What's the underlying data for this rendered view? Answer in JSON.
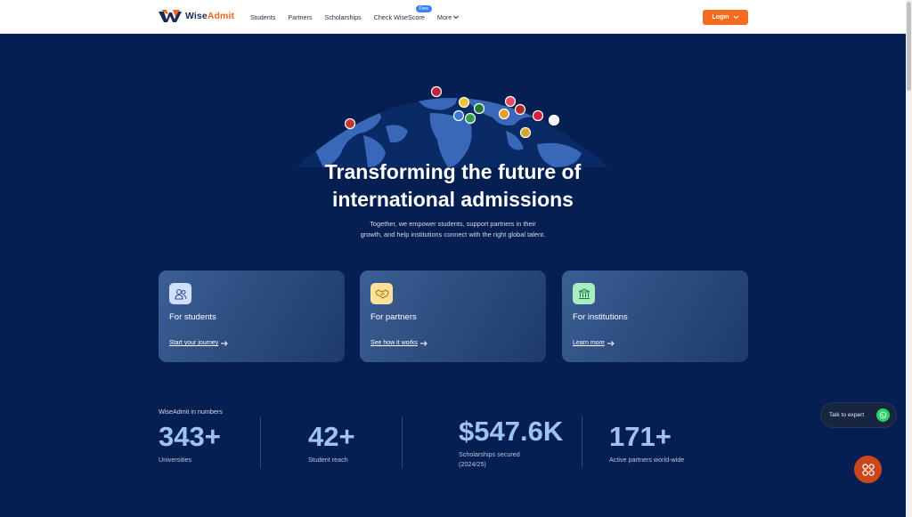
{
  "nav": {
    "logo_prefix": "Wise",
    "logo_suffix": "Admit",
    "links": [
      "Students",
      "Partners",
      "Scholarships",
      "Check WiseScore"
    ],
    "free_badge": "Free",
    "more_label": "More",
    "login_label": "Login"
  },
  "hero": {
    "title_line1": "Transforming the future of",
    "title_line2": "international admissions",
    "subtitle_line1": "Together, we empower students, support partners in their",
    "subtitle_line2": "growth, and help institutions connect with the right global talent."
  },
  "cards": [
    {
      "title": "For students",
      "link": "Start your journey",
      "icon": "users-icon",
      "icon_bg": "#cfe0fb"
    },
    {
      "title": "For partners",
      "link": "See how it works",
      "icon": "handshake-icon",
      "icon_bg": "#fbe19a"
    },
    {
      "title": "For institutions",
      "link": "Learn more",
      "icon": "institution-icon",
      "icon_bg": "#a8ecc2"
    }
  ],
  "stats": {
    "heading": "WiseAdmit in numbers",
    "items": [
      {
        "value": "343+",
        "label": "Universities"
      },
      {
        "value": "42+",
        "label": "Student reach"
      },
      {
        "value": "$547.6K",
        "label": "Scholarships secured",
        "label2": "(2024/25)"
      },
      {
        "value": "171+",
        "label": "Active partners world-wide"
      }
    ]
  },
  "floating": {
    "talk_label": "Talk to expert"
  },
  "colors": {
    "background": "#061f52",
    "accent": "#f46a1f",
    "stat_value": "#9ec2f5"
  }
}
